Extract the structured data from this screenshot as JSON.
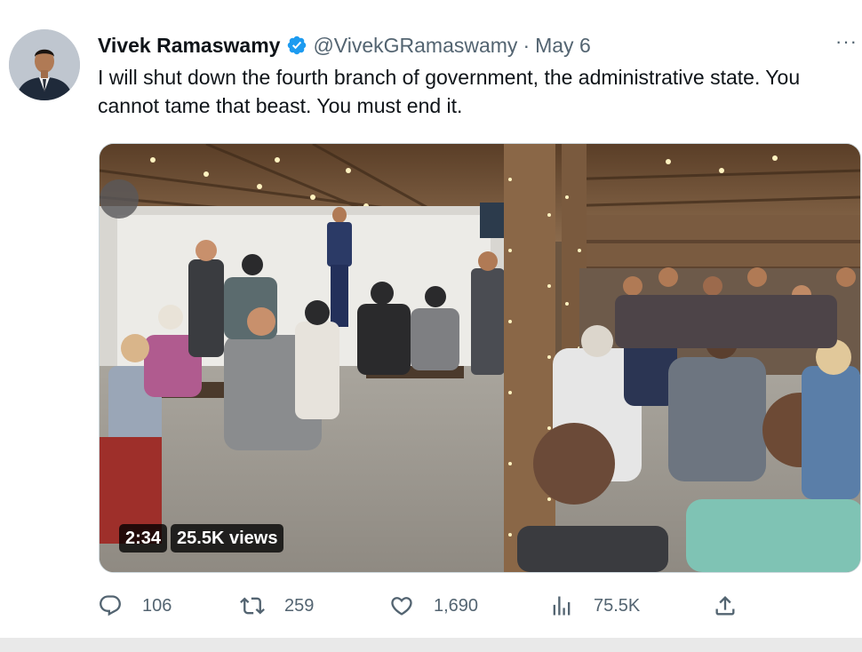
{
  "tweet": {
    "author_name": "Vivek Ramaswamy",
    "handle": "@VivekGRamaswamy",
    "separator": "·",
    "date": "May 6",
    "more_label": "···",
    "text": "I will shut down the fourth branch of government, the administrative state. You cannot tame that beast. You must end it."
  },
  "video": {
    "duration": "2:34",
    "views": "25.5K views"
  },
  "actions": {
    "replies": "106",
    "retweets": "259",
    "likes": "1,690",
    "views": "75.5K"
  },
  "icons": {
    "verified": "verified-badge-icon",
    "reply": "reply-icon",
    "retweet": "retweet-icon",
    "like": "heart-icon",
    "views": "analytics-icon",
    "share": "share-icon"
  },
  "colors": {
    "verified": "#1d9bf0",
    "text_primary": "#0f1419",
    "text_secondary": "#536471",
    "page_background": "#e9e9e9",
    "card_background": "#ffffff"
  }
}
